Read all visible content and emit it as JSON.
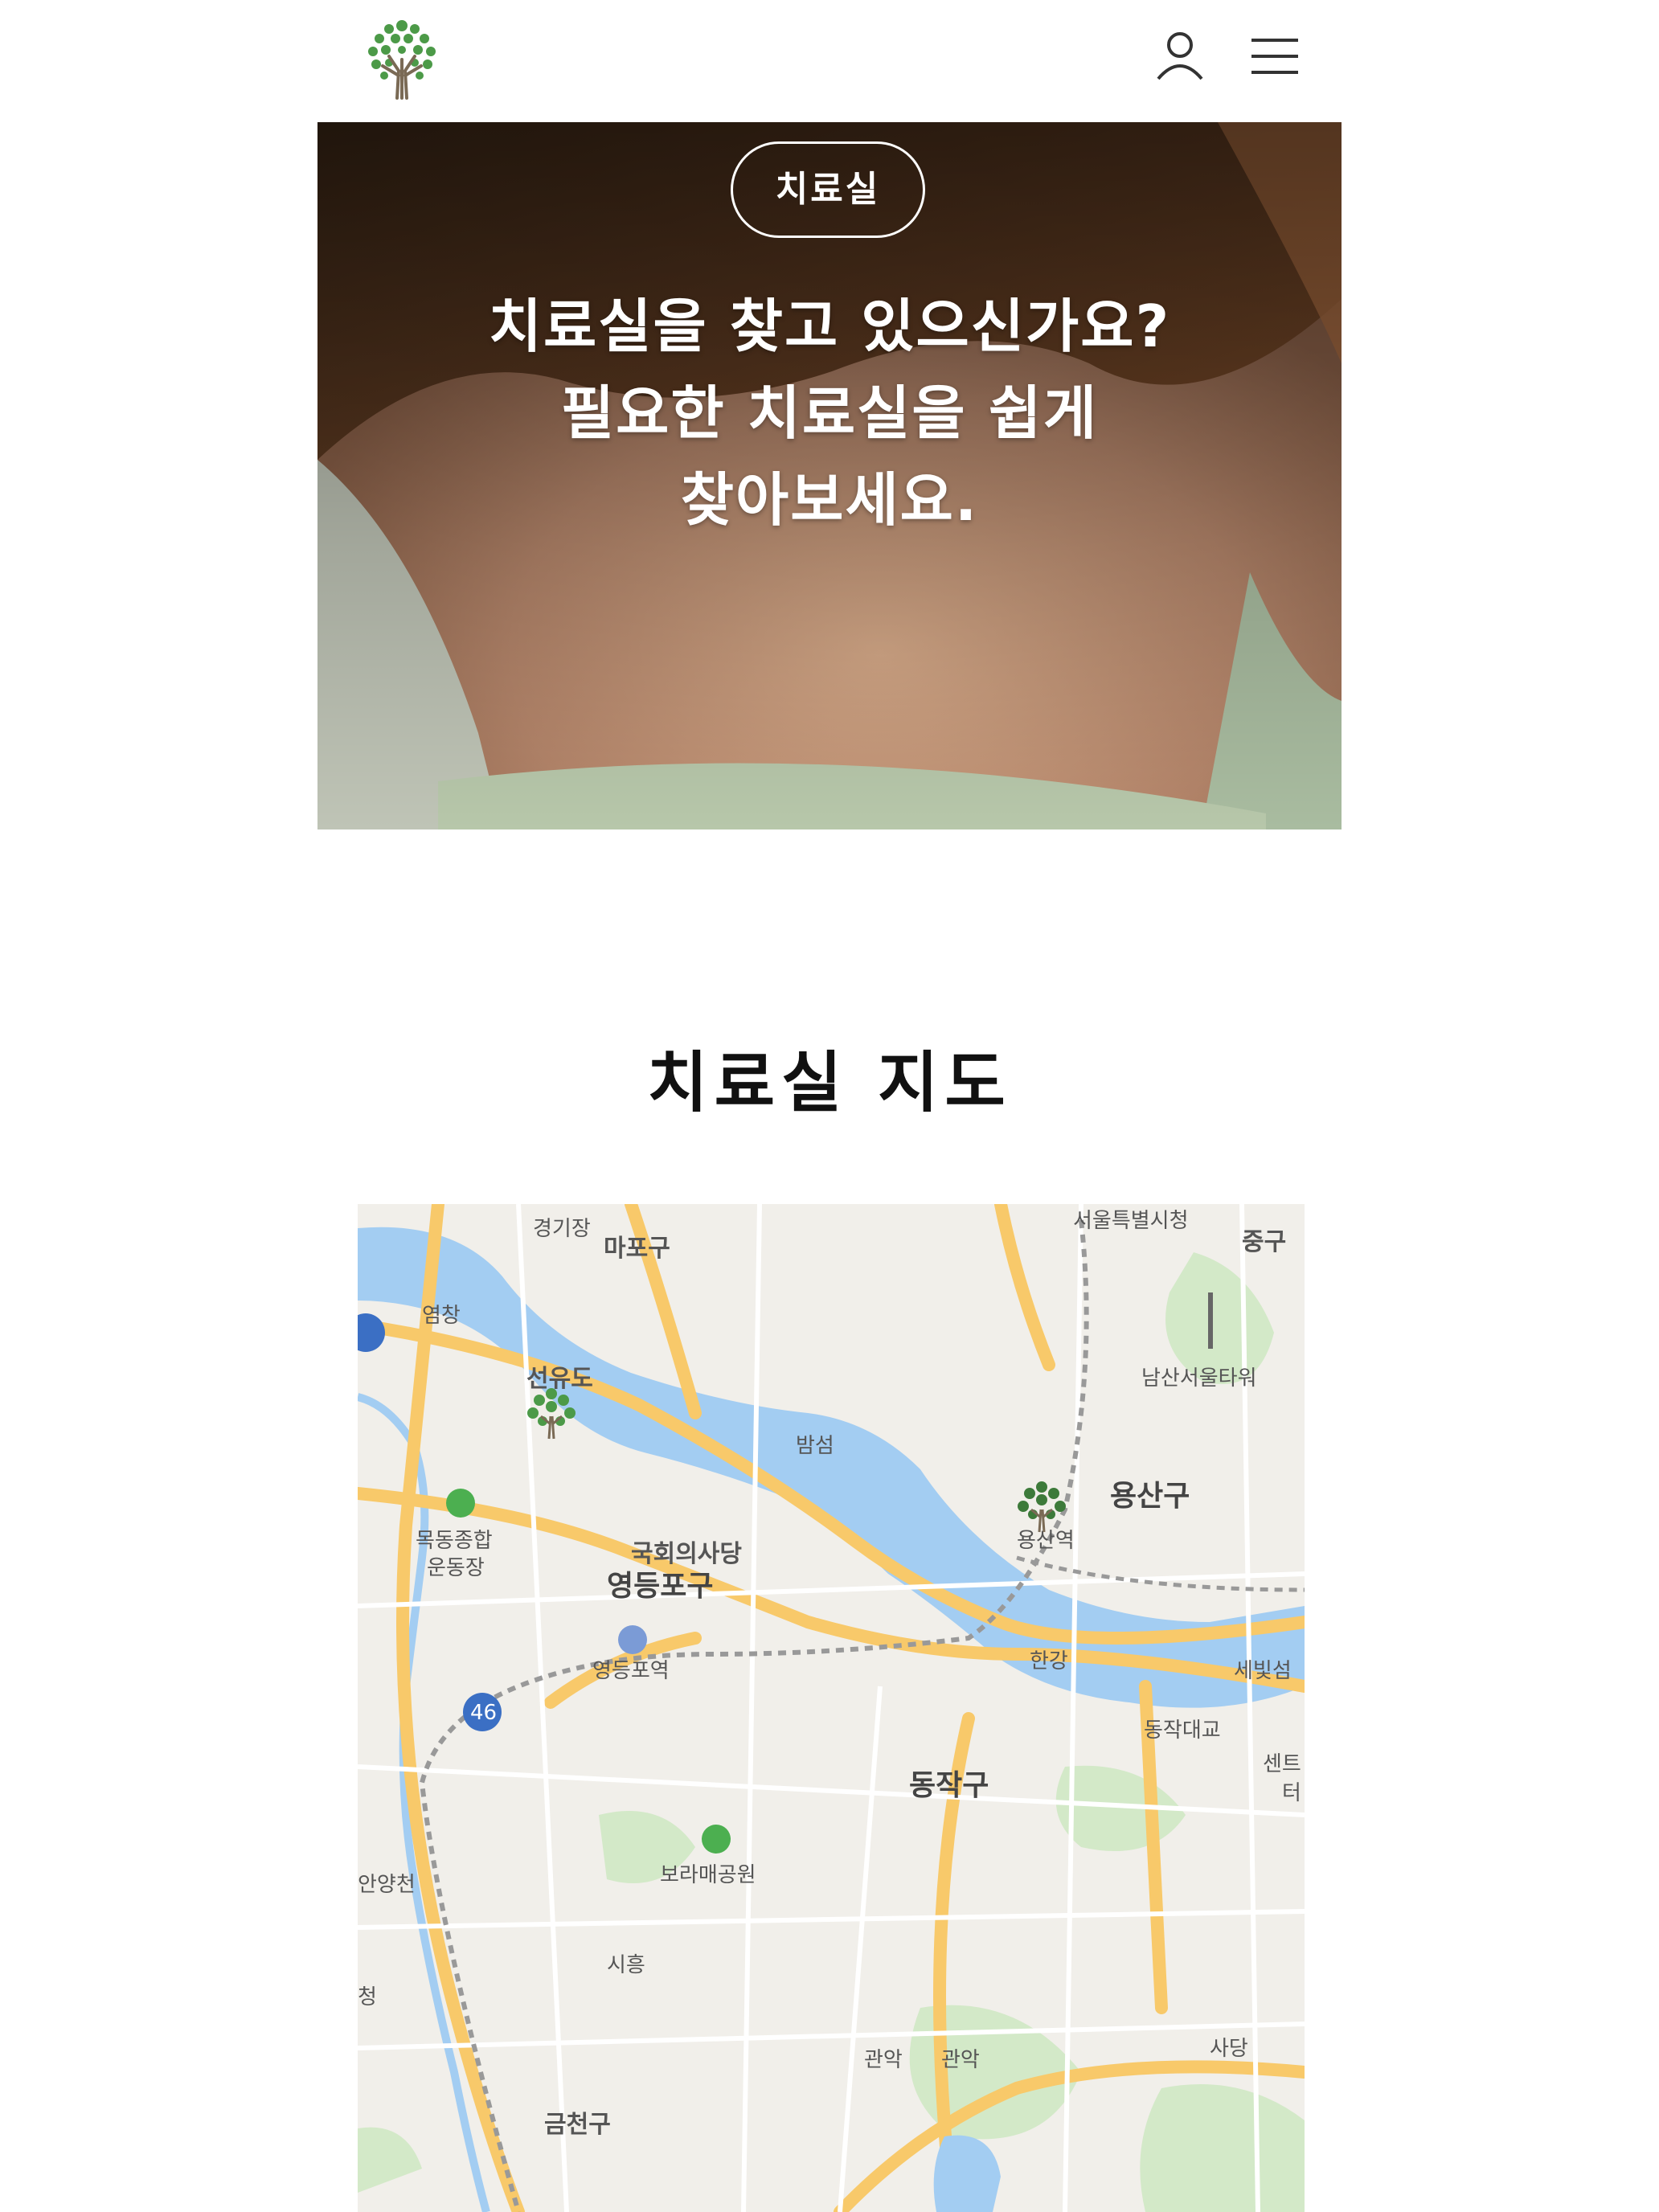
{
  "header": {
    "logo_icon": "tree-logo-icon",
    "user_icon": "user-icon",
    "menu_icon": "hamburger-menu-icon"
  },
  "hero": {
    "badge": "치료실",
    "title_lines": [
      "치료실을 찾고 있으신가요?",
      "필요한 치료실을 쉽게",
      "찾아보세요."
    ]
  },
  "section": {
    "title": "치료실 지도"
  },
  "map": {
    "labels": {
      "mapo": "마포구",
      "gyeonggijang": "경기장",
      "seoul_city_hall": "서울특별시청",
      "junggu": "중구",
      "yeomchang": "염창",
      "seonyudo": "선유도",
      "bamseom": "밤섬",
      "namsan_tower": "남산서울타워",
      "yongsangu": "용산구",
      "yongsan_station": "용산역",
      "mokdong_1": "목동종합",
      "mokdong_2": "운동장",
      "national_assembly": "국회의사당",
      "yeongdeungpo_gu": "영등포구",
      "yeongdeungpo_station": "영등포역",
      "hangang": "한강",
      "saebitseom": "세빛섬",
      "dongjak_bridge": "동작대교",
      "center_1": "센트",
      "center_2": "터",
      "dongjak_gu": "동작구",
      "boramae": "보라매공원",
      "anyangcheon": "안양천",
      "siheung": "시흥",
      "cheong": "청",
      "gwanak_1": "관악",
      "gwanak_2": "관악",
      "sadang": "사당",
      "geumcheon": "금천구",
      "route_46": "46"
    }
  }
}
